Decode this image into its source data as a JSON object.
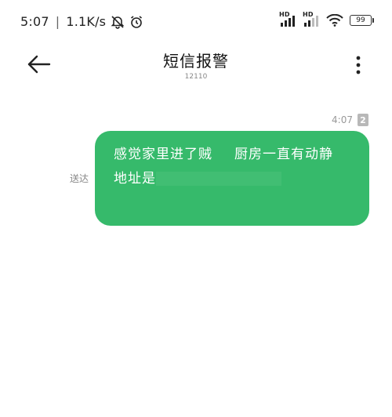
{
  "status_bar": {
    "time": "5:07",
    "network_speed": "1.1K/s",
    "hd_label_1": "HD",
    "hd_label_2": "HD",
    "battery_level": "99",
    "icons": [
      "bell-muted-icon",
      "alarm-clock-icon",
      "signal-icon",
      "signal-icon",
      "wifi-icon",
      "battery-icon"
    ]
  },
  "header": {
    "title": "短信报警",
    "subtitle": "12110"
  },
  "message": {
    "time": "4:07",
    "sim_slot": "2",
    "status": "送达",
    "line1_a": "感觉家里进了贼",
    "line1_b": "厨房一直有动静",
    "line2": "地址是"
  },
  "colors": {
    "bubble": "#36ba6b",
    "background": "#ffffff"
  }
}
